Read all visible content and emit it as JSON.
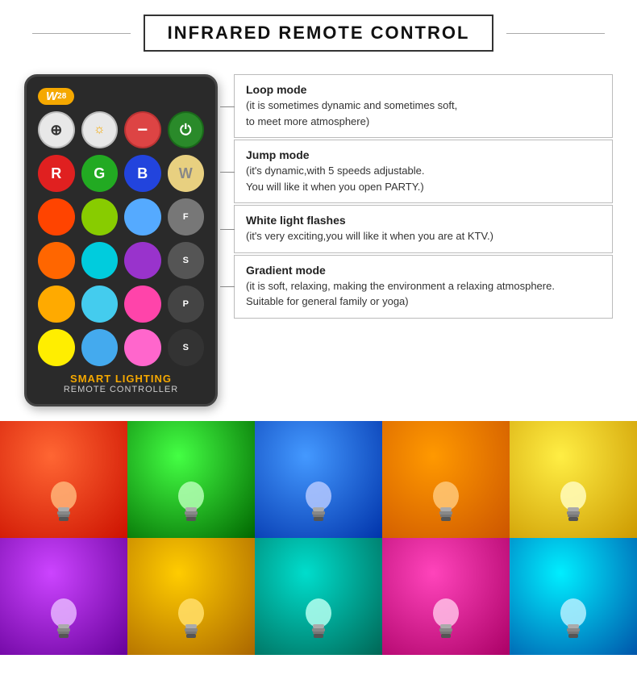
{
  "header": {
    "title": "INFRARED REMOTE CONTROL"
  },
  "remote": {
    "badge": "W",
    "badge_sup": "28",
    "label_smart": "SMART LIGHTING",
    "label_sub": "REMOTE CONTROLLER",
    "btn_row1": [
      {
        "id": "nav",
        "symbol": "⊕",
        "style": "nav"
      },
      {
        "id": "sun",
        "symbol": "☼",
        "style": "sun"
      },
      {
        "id": "minus",
        "symbol": "−",
        "style": "minus"
      },
      {
        "id": "power",
        "symbol": "⏻",
        "style": "circle-green"
      }
    ],
    "btn_row2": [
      {
        "label": "R",
        "style": "r"
      },
      {
        "label": "G",
        "style": "g"
      },
      {
        "label": "B",
        "style": "b"
      },
      {
        "label": "W",
        "style": "w"
      }
    ],
    "color_rows": [
      [
        {
          "color": "#ff4400"
        },
        {
          "color": "#88dd00"
        },
        {
          "color": "#44aaff"
        },
        {
          "label": "F",
          "bg": "#888888"
        }
      ],
      [
        {
          "color": "#ff6600"
        },
        {
          "color": "#00ccee"
        },
        {
          "color": "#aa44cc"
        },
        {
          "label": "S",
          "bg": "#666666"
        }
      ],
      [
        {
          "color": "#ffaa00"
        },
        {
          "color": "#44ccee"
        },
        {
          "color": "#ff44aa"
        },
        {
          "label": "P",
          "bg": "#555555"
        }
      ],
      [
        {
          "color": "#ffdd00"
        },
        {
          "color": "#44bbee"
        },
        {
          "color": "#ff66cc"
        },
        {
          "label": "S",
          "bg": "#444444"
        }
      ]
    ]
  },
  "info_boxes": [
    {
      "id": "loop",
      "title": "Loop mode",
      "desc": "(it is sometimes dynamic and sometimes soft,\nto meet more atmosphere)"
    },
    {
      "id": "jump",
      "title": "Jump mode",
      "desc": "(it's dynamic,with 5 speeds adjustable.\nYou will like it when you open PARTY.)"
    },
    {
      "id": "flash",
      "title": "White light flashes",
      "desc": "(it's very exciting,you will like it when you are at KTV.)"
    },
    {
      "id": "gradient",
      "title": "Gradient mode",
      "desc": "(it is soft, relaxing, making the environment a relaxing atmosphere.\nSuitable for general family or yoga)"
    }
  ],
  "color_cells": [
    {
      "id": "red",
      "class": "cell-red"
    },
    {
      "id": "green",
      "class": "cell-green"
    },
    {
      "id": "blue",
      "class": "cell-blue"
    },
    {
      "id": "orange",
      "class": "cell-orange"
    },
    {
      "id": "yellow",
      "class": "cell-yellow"
    },
    {
      "id": "purple",
      "class": "cell-purple"
    },
    {
      "id": "amber",
      "class": "cell-amber"
    },
    {
      "id": "teal",
      "class": "cell-teal"
    },
    {
      "id": "pink",
      "class": "cell-pink"
    },
    {
      "id": "cyan",
      "class": "cell-cyan"
    }
  ]
}
